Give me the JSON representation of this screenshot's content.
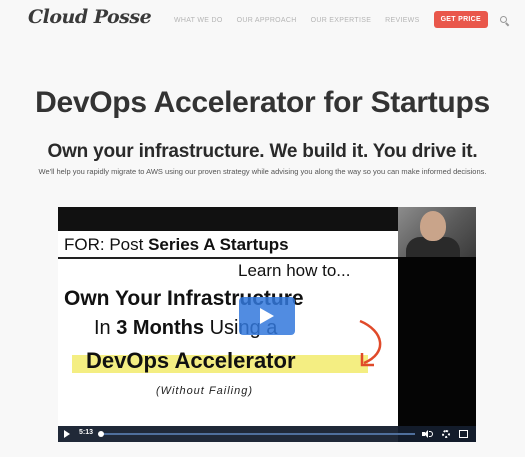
{
  "header": {
    "logo": "Cloud Posse",
    "nav": [
      "WHAT WE DO",
      "OUR APPROACH",
      "OUR EXPERTISE",
      "REVIEWS"
    ],
    "cta": "GET PRICE",
    "search_icon": "search-icon"
  },
  "hero": {
    "title": "DevOps Accelerator for Startups",
    "subtitle": "Own your infrastructure. We build it. You drive it.",
    "description": "We'll help you rapidly migrate to AWS using our proven strategy while advising you along the way so you can make informed decisions."
  },
  "video": {
    "line1_prefix": "FOR: Post ",
    "line1_bold": "Series A Startups",
    "line2": "Learn how to...",
    "line3": "Own Your Infrastructure",
    "line4_a": "In ",
    "line4_b": "3 Months",
    "line4_c": " Using a",
    "line5": "DevOps Accelerator",
    "line6": "(Without Failing)",
    "time": "5:13",
    "progress": 0.0,
    "accent": "#3278dc",
    "highlight": "#f4ee82"
  }
}
